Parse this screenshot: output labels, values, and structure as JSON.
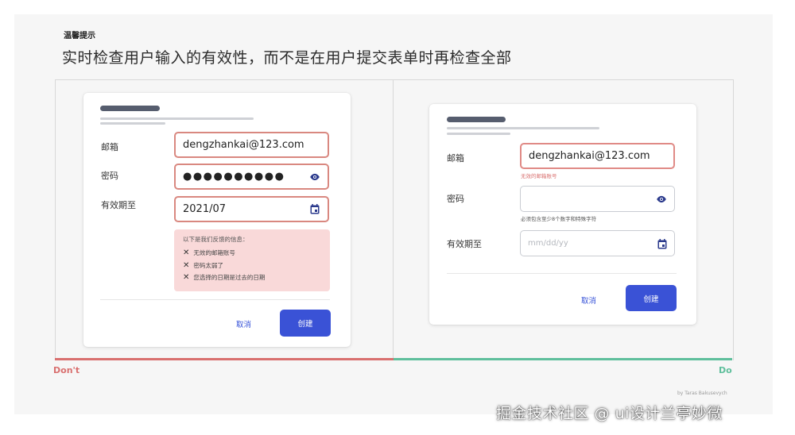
{
  "header": {
    "tip": "温馨提示",
    "headline": "实时检查用户输入的有效性，而不是在用户提交表单时再检查全部"
  },
  "dont_form": {
    "email_label": "邮箱",
    "email_value": "dengzhankai@123.com",
    "password_label": "密码",
    "password_value": "●●●●●●●●●●",
    "expiry_label": "有效期至",
    "expiry_value": "2021/07",
    "error_box": {
      "title": "以下是我们反馈的信息：",
      "items": [
        "无效的邮箱账号",
        "密码太弱了",
        "您选择的日期是过去的日期"
      ]
    },
    "cancel_label": "取消",
    "create_label": "创建"
  },
  "do_form": {
    "email_label": "邮箱",
    "email_value": "dengzhankai@123.com",
    "email_hint": "无效的邮箱账号",
    "password_label": "密码",
    "password_value": "",
    "password_hint": "必须包含至少8个数字和特殊字符",
    "expiry_label": "有效期至",
    "expiry_placeholder": "mm/dd/yy",
    "cancel_label": "取消",
    "create_label": "创建"
  },
  "labels": {
    "dont": "Don't",
    "do": "Do",
    "credit": "by Taras Bakusevych",
    "watermark": "掘金技术社区 @ ui设计兰亭妙微"
  },
  "colors": {
    "dont": "#d9706f",
    "do": "#5fbf9c",
    "primary_button": "#3a52d6",
    "error_border": "#e08a86",
    "error_box_bg": "#f9d9d9"
  },
  "icons": [
    "eye-icon",
    "calendar-icon",
    "x-icon"
  ]
}
